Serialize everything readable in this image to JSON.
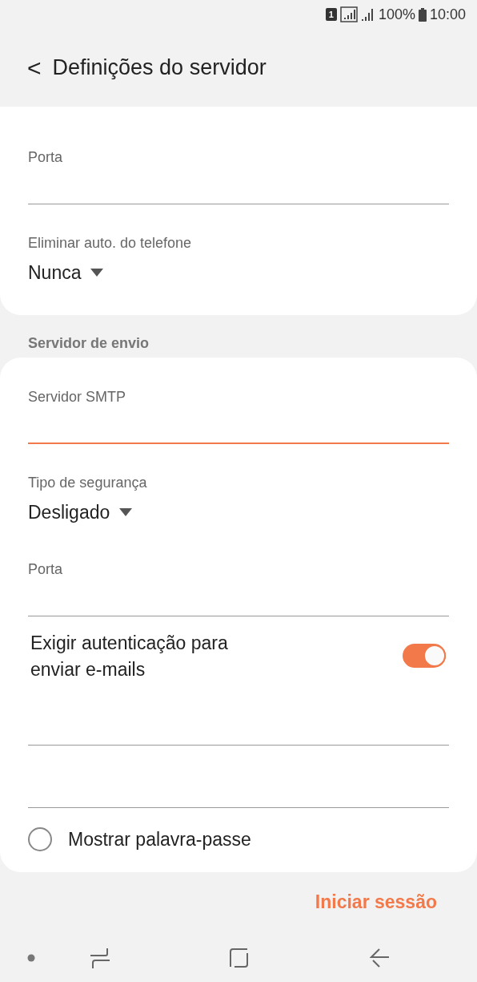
{
  "status_bar": {
    "sim": "1",
    "battery": "100%",
    "time": "10:00"
  },
  "header": {
    "back": "<",
    "title": "Definições do servidor"
  },
  "incoming_card": {
    "items": [
      {
        "kind": "text_field",
        "label": "Porta",
        "focused": false
      },
      {
        "kind": "dropdown",
        "label": "Eliminar auto. do telefone",
        "value": "Nunca"
      }
    ]
  },
  "outgoing_section": {
    "title": "Servidor de envio"
  },
  "outgoing_card": {
    "items": [
      {
        "kind": "text_field",
        "label": "Servidor SMTP",
        "focused": true
      },
      {
        "kind": "dropdown",
        "label": "Tipo de segurança",
        "value": "Desligado"
      },
      {
        "kind": "text_field",
        "label": "Porta",
        "focused": false
      },
      {
        "kind": "switch",
        "label": "Exigir autenticação para enviar e-mails",
        "on": true
      },
      {
        "kind": "text_field",
        "focused": false
      },
      {
        "kind": "text_field",
        "focused": false
      },
      {
        "kind": "checkbox",
        "label": "Mostrar palavra-passe",
        "checked": false
      }
    ]
  },
  "action": {
    "label": "Iniciar sessão"
  }
}
